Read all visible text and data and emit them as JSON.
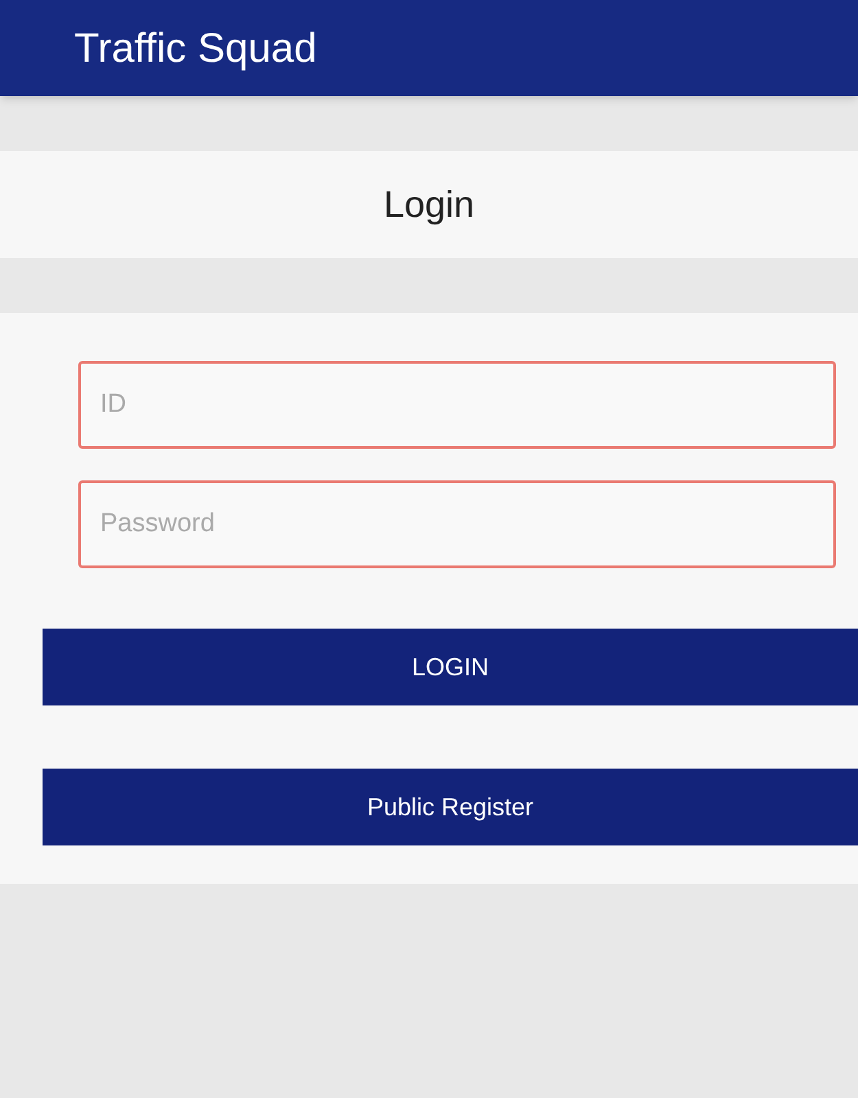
{
  "app_bar": {
    "title": "Traffic Squad"
  },
  "page_title": "Login",
  "fields": [
    {
      "placeholder": "ID"
    },
    {
      "placeholder": "Password"
    }
  ],
  "buttons": [
    "LOGIN",
    "Public Register"
  ]
}
